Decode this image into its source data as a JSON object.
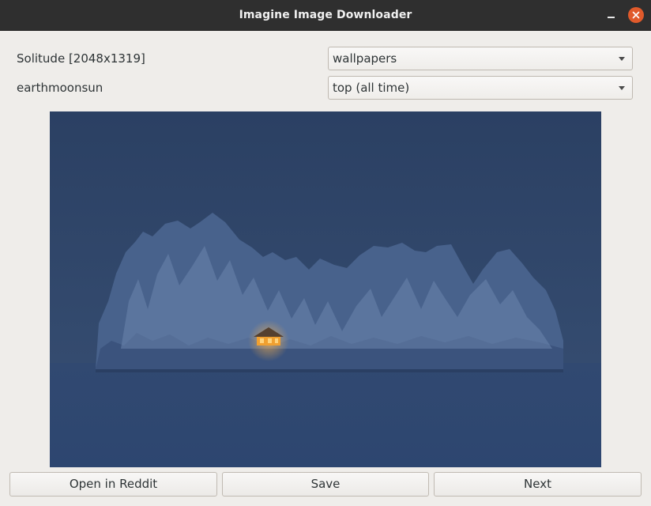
{
  "window": {
    "title": "Imagine Image Downloader"
  },
  "image_info": {
    "title": "Solitude [2048x1319]",
    "author": "earthmoonsun"
  },
  "subreddit_select": {
    "value": "wallpapers"
  },
  "sort_select": {
    "value": "top (all time)"
  },
  "buttons": {
    "open_reddit": "Open in Reddit",
    "save": "Save",
    "next": "Next"
  },
  "colors": {
    "titlebar": "#2f2f2f",
    "close_button": "#e05a2b",
    "window_bg": "#efedea",
    "image_sky": "#2e4466"
  }
}
